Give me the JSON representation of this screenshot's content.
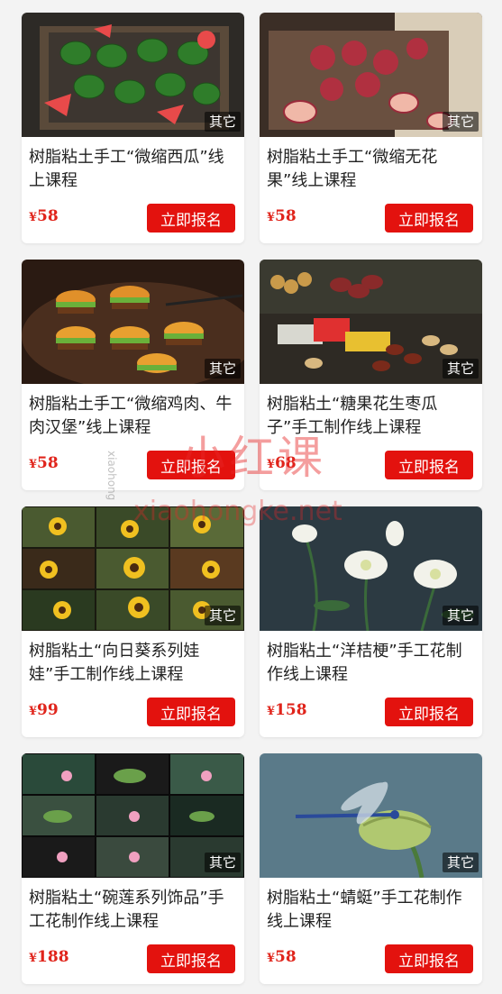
{
  "cards": [
    {
      "title": "树脂粘土手工“微缩西瓜”线上课程",
      "price": "58",
      "badge": "其它",
      "button": "立即报名",
      "image": "watermelon-tray-image"
    },
    {
      "title": "树脂粘土手工“微缩无花果”线上课程",
      "price": "58",
      "badge": "其它",
      "button": "立即报名",
      "image": "fig-tray-image"
    },
    {
      "title": "树脂粘土手工“微缩鸡肉、牛肉汉堡”线上课程",
      "price": "58",
      "badge": "其它",
      "button": "立即报名",
      "image": "mini-burger-image"
    },
    {
      "title": "树脂粘土“糖果花生枣瓜子”手工制作线上课程",
      "price": "68",
      "badge": "其它",
      "button": "立即报名",
      "image": "candy-snacks-image"
    },
    {
      "title": "树脂粘土“向日葵系列娃娃”手工制作线上课程",
      "price": "99",
      "badge": "其它",
      "button": "立即报名",
      "image": "sunflower-collage-image"
    },
    {
      "title": "树脂粘土“洋桔梗”手工花制作线上课程",
      "price": "158",
      "badge": "其它",
      "button": "立即报名",
      "image": "eustoma-flower-image"
    },
    {
      "title": "树脂粘土“碗莲系列饰品”手工花制作线上课程",
      "price": "188",
      "badge": "其它",
      "button": "立即报名",
      "image": "lotus-jewelry-image"
    },
    {
      "title": "树脂粘土“蜻蜓”手工花制作线上课程",
      "price": "58",
      "badge": "其它",
      "button": "立即报名",
      "image": "dragonfly-bud-image"
    }
  ],
  "currency_symbol": "¥",
  "watermark": {
    "brand": "小红课",
    "url": "xiaohongke.net",
    "side_text": "xiaohong"
  },
  "colors": {
    "accent": "#e3120e",
    "price": "#e0241b",
    "background": "#f3f3f3"
  }
}
